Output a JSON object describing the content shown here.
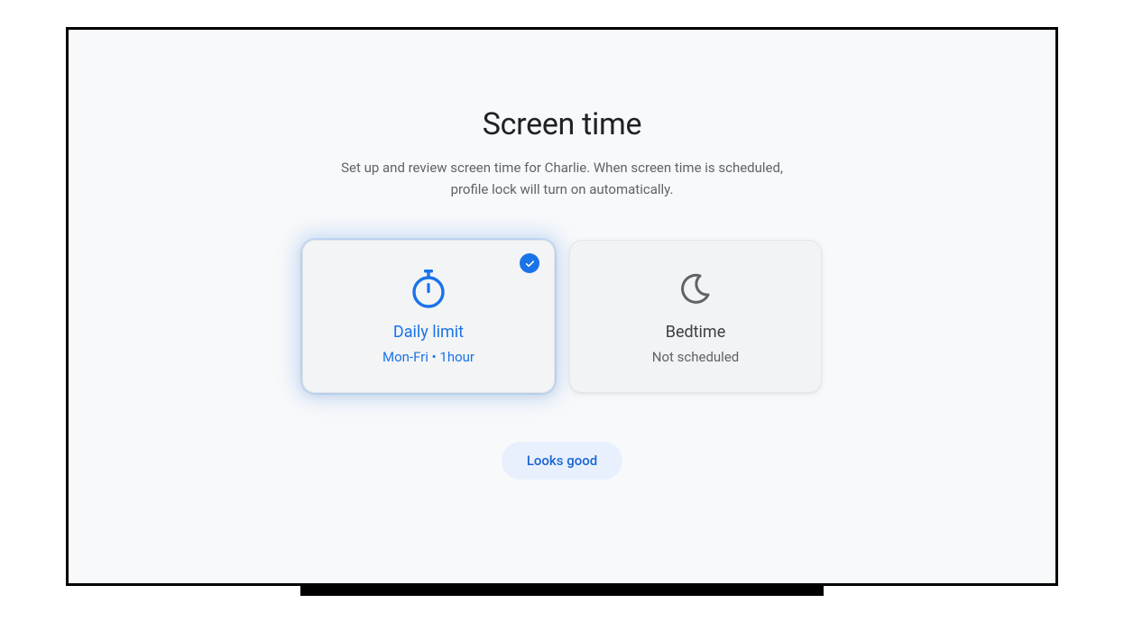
{
  "header": {
    "title": "Screen time",
    "subtitle": "Set up and review screen time for Charlie. When screen time is scheduled, profile lock will turn on automatically."
  },
  "cards": {
    "daily_limit": {
      "title": "Daily limit",
      "subtitle": "Mon-Fri • 1hour",
      "selected": true
    },
    "bedtime": {
      "title": "Bedtime",
      "subtitle": "Not scheduled",
      "selected": false
    }
  },
  "confirm_button_label": "Looks good",
  "colors": {
    "accent": "#1a73e8",
    "text_primary": "#202124",
    "text_secondary": "#5f6368",
    "button_bg": "#e8f0fe",
    "card_bg": "#f1f3f4"
  }
}
